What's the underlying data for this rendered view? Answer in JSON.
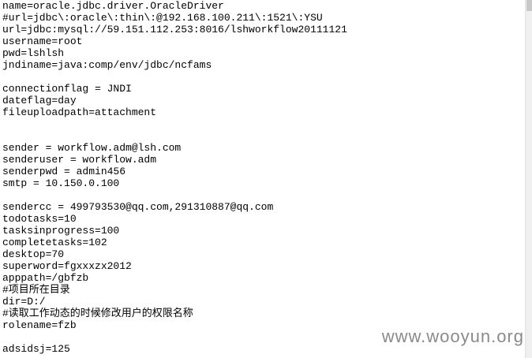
{
  "lines": [
    "name=oracle.jdbc.driver.OracleDriver",
    "#url=jdbc\\:oracle\\:thin\\:@192.168.100.211\\:1521\\:YSU",
    "url=jdbc:mysql://59.151.112.253:8016/lshworkflow20111121",
    "username=root",
    "pwd=lshlsh",
    "jndiname=java:comp/env/jdbc/ncfams",
    "",
    "connectionflag = JNDI",
    "dateflag=day",
    "fileuploadpath=attachment",
    "",
    "",
    "sender = workflow.adm@lsh.com",
    "senderuser = workflow.adm",
    "senderpwd = admin456",
    "smtp = 10.150.0.100",
    "",
    "sendercc = 499793530@qq.com,291310887@qq.com",
    "todotasks=10",
    "tasksinprogress=100",
    "completetasks=102",
    "desktop=70",
    "superword=fgxxxzx2012",
    "apppath=/gbfzb",
    "#项目所在目录",
    "dir=D:/",
    "#读取工作动态的时候修改用户的权限名称",
    "rolename=fzb",
    "",
    "adsidsj=125"
  ],
  "watermark": "www.wooyun.org"
}
